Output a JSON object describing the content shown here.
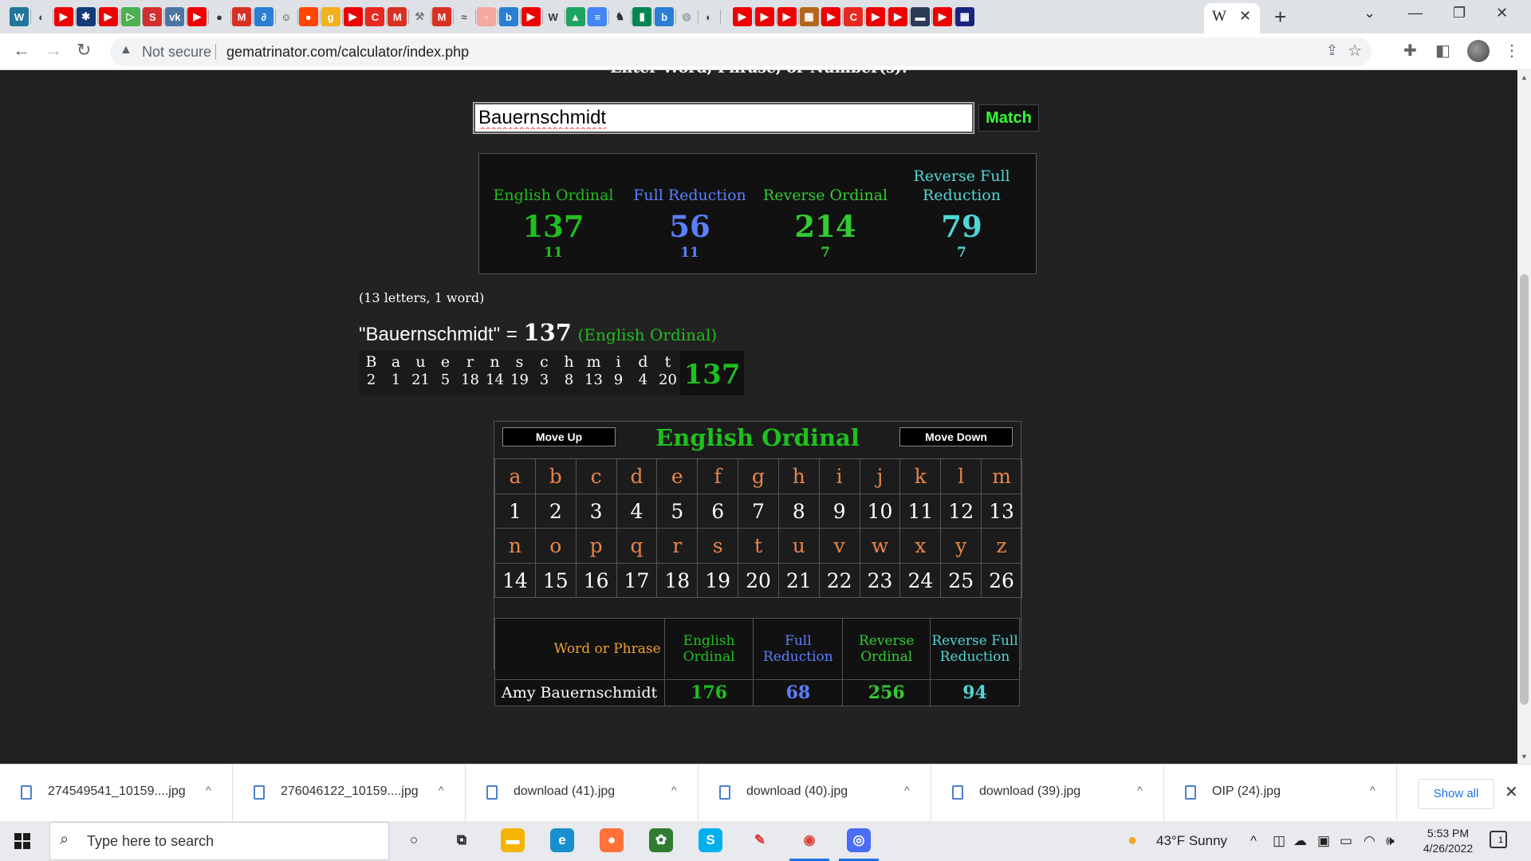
{
  "browser": {
    "tab_icons": [
      {
        "name": "wordpress-icon",
        "glyph": "W",
        "color": "#21759b"
      },
      {
        "name": "globe-icon",
        "glyph": "◐",
        "color": "#444"
      },
      {
        "name": "youtube-icon",
        "glyph": "▶",
        "color": "#e00"
      },
      {
        "name": "bookmark-icon",
        "glyph": "✱",
        "color": "#123a7a"
      },
      {
        "name": "youtube-icon",
        "glyph": "▶",
        "color": "#e00"
      },
      {
        "name": "play-icon",
        "glyph": "▷",
        "color": "#4caf50"
      },
      {
        "name": "sun-icon",
        "glyph": "S",
        "color": "#d32f2f"
      },
      {
        "name": "vk-icon",
        "glyph": "vk",
        "color": "#4c75a3"
      },
      {
        "name": "youtube-icon",
        "glyph": "▶",
        "color": "#e00"
      },
      {
        "name": "record-icon",
        "glyph": "●",
        "color": "#333"
      },
      {
        "name": "gmail-icon",
        "glyph": "M",
        "color": "#d93025"
      },
      {
        "name": "app-icon",
        "glyph": "∂",
        "color": "#2a7fd4"
      },
      {
        "name": "face-icon",
        "glyph": "☺",
        "color": "#333"
      },
      {
        "name": "reddit-icon",
        "glyph": "●",
        "color": "#ff4500"
      },
      {
        "name": "g-icon",
        "glyph": "g",
        "color": "#f2b01e"
      },
      {
        "name": "youtube-icon",
        "glyph": "▶",
        "color": "#e00"
      },
      {
        "name": "c-icon",
        "glyph": "C",
        "color": "#e8281e"
      },
      {
        "name": "gmail-icon",
        "glyph": "M",
        "color": "#d93025"
      },
      {
        "name": "tool-icon",
        "glyph": "⚒",
        "color": "#777"
      },
      {
        "name": "gmail-icon",
        "glyph": "M",
        "color": "#d93025"
      },
      {
        "name": "wave-icon",
        "glyph": "≈",
        "color": "#555"
      },
      {
        "name": "page-icon",
        "glyph": "▫",
        "color": "#f4a8a0"
      },
      {
        "name": "bing-icon",
        "glyph": "b",
        "color": "#2a7fd4"
      },
      {
        "name": "youtube-icon",
        "glyph": "▶",
        "color": "#e00"
      },
      {
        "name": "wikipedia-icon",
        "glyph": "W",
        "color": "#333"
      },
      {
        "name": "drive-icon",
        "glyph": "▲",
        "color": "#1ea362"
      },
      {
        "name": "docs-icon",
        "glyph": "≡",
        "color": "#4285f4"
      },
      {
        "name": "figure-icon",
        "glyph": "♞",
        "color": "#333"
      },
      {
        "name": "flag-icon",
        "glyph": "▮",
        "color": "#008751"
      },
      {
        "name": "bing-icon",
        "glyph": "b",
        "color": "#2a7fd4"
      },
      {
        "name": "globe-icon",
        "glyph": "◍",
        "color": "#9aa"
      },
      {
        "name": "globe-icon",
        "glyph": "◐",
        "color": "#444"
      },
      {
        "name": "youtube-icon",
        "glyph": "▶",
        "color": "#e00"
      },
      {
        "name": "youtube-icon",
        "glyph": "▶",
        "color": "#e00"
      },
      {
        "name": "youtube-icon",
        "glyph": "▶",
        "color": "#e00"
      },
      {
        "name": "image-icon",
        "glyph": "▦",
        "color": "#b5651d"
      },
      {
        "name": "youtube-icon",
        "glyph": "▶",
        "color": "#e00"
      },
      {
        "name": "c-icon",
        "glyph": "C",
        "color": "#e8281e"
      },
      {
        "name": "youtube-icon",
        "glyph": "▶",
        "color": "#e00"
      },
      {
        "name": "youtube-icon",
        "glyph": "▶",
        "color": "#e00"
      },
      {
        "name": "image-icon",
        "glyph": "▬",
        "color": "#2b3a55"
      },
      {
        "name": "youtube-icon",
        "glyph": "▶",
        "color": "#e00"
      },
      {
        "name": "grid-icon",
        "glyph": "▦",
        "color": "#1a237e"
      }
    ],
    "active_tab_favicon": "W",
    "address": {
      "security_label": "Not secure",
      "url": "gematrinator.com/calculator/index.php"
    }
  },
  "page": {
    "heading": "Enter Word, Phrase, or Number(s):",
    "search_value": "Bauernschmidt",
    "match_label": "Match",
    "summary": [
      {
        "label": "English Ordinal",
        "value": "137",
        "reduced": "11",
        "color": "#1fbf1f"
      },
      {
        "label": "Full Reduction",
        "value": "56",
        "reduced": "11",
        "color": "#5b7fff"
      },
      {
        "label": "Reverse Ordinal",
        "value": "214",
        "reduced": "7",
        "color": "#33cc33"
      },
      {
        "label": "Reverse Full Reduction",
        "value": "79",
        "reduced": "7",
        "color": "#4fd6d6"
      }
    ],
    "letter_count": "(13 letters, 1 word)",
    "equation": {
      "phrase": "\"Bauernschmidt\"",
      "equals": "=",
      "value": "137",
      "cipher": "(English Ordinal)"
    },
    "breakdown": {
      "letters": [
        "B",
        "a",
        "u",
        "e",
        "r",
        "n",
        "s",
        "c",
        "h",
        "m",
        "i",
        "d",
        "t"
      ],
      "values": [
        "2",
        "1",
        "21",
        "5",
        "18",
        "14",
        "19",
        "3",
        "8",
        "13",
        "9",
        "4",
        "20"
      ],
      "total": "137"
    },
    "cipher_chart": {
      "move_up": "Move Up",
      "title": "English Ordinal",
      "move_down": "Move Down",
      "rows": [
        {
          "letters": [
            "a",
            "b",
            "c",
            "d",
            "e",
            "f",
            "g",
            "h",
            "i",
            "j",
            "k",
            "l",
            "m"
          ],
          "values": [
            "1",
            "2",
            "3",
            "4",
            "5",
            "6",
            "7",
            "8",
            "9",
            "10",
            "11",
            "12",
            "13"
          ]
        },
        {
          "letters": [
            "n",
            "o",
            "p",
            "q",
            "r",
            "s",
            "t",
            "u",
            "v",
            "w",
            "x",
            "y",
            "z"
          ],
          "values": [
            "14",
            "15",
            "16",
            "17",
            "18",
            "19",
            "20",
            "21",
            "22",
            "23",
            "24",
            "25",
            "26"
          ]
        }
      ]
    },
    "results_table": {
      "headers": [
        {
          "label": "Word or Phrase",
          "color": "#f0a030"
        },
        {
          "label": "English Ordinal",
          "color": "#1fbf1f"
        },
        {
          "label": "Full Reduction",
          "color": "#5b7fff"
        },
        {
          "label": "Reverse Ordinal",
          "color": "#33cc33"
        },
        {
          "label": "Reverse Full Reduction",
          "color": "#4fd6d6"
        }
      ],
      "rows": [
        {
          "phrase": "Amy Bauernschmidt",
          "values": [
            "176",
            "68",
            "256",
            "94"
          ]
        }
      ]
    }
  },
  "downloads": {
    "items": [
      "274549541_10159....jpg",
      "276046122_10159....jpg",
      "download (41).jpg",
      "download (40).jpg",
      "download (39).jpg",
      "OIP (24).jpg"
    ],
    "show_all": "Show all"
  },
  "taskbar": {
    "search_placeholder": "Type here to search",
    "apps": [
      {
        "name": "cortana-icon",
        "glyph": "○",
        "color": "#e8eaed",
        "fg": "#222"
      },
      {
        "name": "task-view-icon",
        "glyph": "⧉",
        "color": "#e8eaed",
        "fg": "#222"
      },
      {
        "name": "file-explorer-icon",
        "glyph": "▬",
        "color": "#f4b400",
        "fg": "#fff"
      },
      {
        "name": "edge-icon",
        "glyph": "e",
        "color": "#1a8fcf",
        "fg": "#fff"
      },
      {
        "name": "firefox-icon",
        "glyph": "●",
        "color": "#ff7139",
        "fg": "#fff"
      },
      {
        "name": "photo-app-icon",
        "glyph": "✿",
        "color": "#2e7d32",
        "fg": "#fff"
      },
      {
        "name": "skype-icon",
        "glyph": "S",
        "color": "#00aff0",
        "fg": "#fff"
      },
      {
        "name": "paint-icon",
        "glyph": "✎",
        "color": "#e8eaed",
        "fg": "#d33"
      },
      {
        "name": "chrome-icon",
        "glyph": "◉",
        "color": "#e8eaed",
        "fg": "#db4437"
      },
      {
        "name": "app-icon",
        "glyph": "◎",
        "color": "#4a6cf7",
        "fg": "#fff"
      }
    ],
    "weather": "43°F  Sunny",
    "time": "5:53 PM",
    "date": "4/26/2022",
    "notification_count": "1"
  }
}
